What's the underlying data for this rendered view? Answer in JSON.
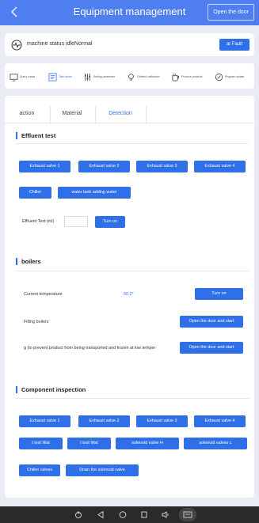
{
  "header": {
    "title": "Equipment management",
    "open_door": "Open the door"
  },
  "status": {
    "text": "machine status  idleNormal",
    "fault_button": "ar Fault"
  },
  "toolbar": {
    "items": [
      {
        "label": "Query status",
        "icon": "monitor-icon"
      },
      {
        "label": "Take action",
        "icon": "list-icon"
      },
      {
        "label": "Setting parameter",
        "icon": "sliders-icon"
      },
      {
        "label": "Outfeed calibration",
        "icon": "bulb-icon"
      },
      {
        "label": "Produce products",
        "icon": "cup-icon"
      },
      {
        "label": "Program update",
        "icon": "refresh-icon"
      }
    ]
  },
  "tabs": [
    "action",
    "Material",
    "Detection"
  ],
  "effluent": {
    "title": "Effluent test",
    "valves": [
      "Exhaust valve 1",
      "Exhaust valve 2",
      "Exhaust valve 3",
      "Exhaust valve 4"
    ],
    "chiller": "Chiller",
    "water_tank": "water tank adding water",
    "test_label": "Effluent Test (ml)",
    "test_value": "",
    "turn_on": "Turn on"
  },
  "boilers": {
    "title": "boilers",
    "current_temp_label": "Current temperature",
    "current_temp_value": "60.2°",
    "turn_on": "Turn on",
    "filling_label": "Filling boilers",
    "filling_button": "Open the door and start",
    "freeze_label": "g (to prevent product from being transported and frozen at low temper",
    "freeze_button": "Open the door and start"
  },
  "component": {
    "title": "Component inspection",
    "valves": [
      "Exhaust valve 1",
      "Exhaust valve 2",
      "Exhaust valve 3",
      "Exhaust valve 4"
    ],
    "row2": [
      "t test    Wat",
      "t test    Wat",
      "solenoid valve         H",
      "solenoid valves         L"
    ],
    "chiller_valves": "Chiller valves",
    "drain": "Drain the solenoid valve"
  },
  "colors": {
    "header": "#4f7ef0",
    "primary": "#2f6fe8",
    "background": "#e9ecf3"
  }
}
